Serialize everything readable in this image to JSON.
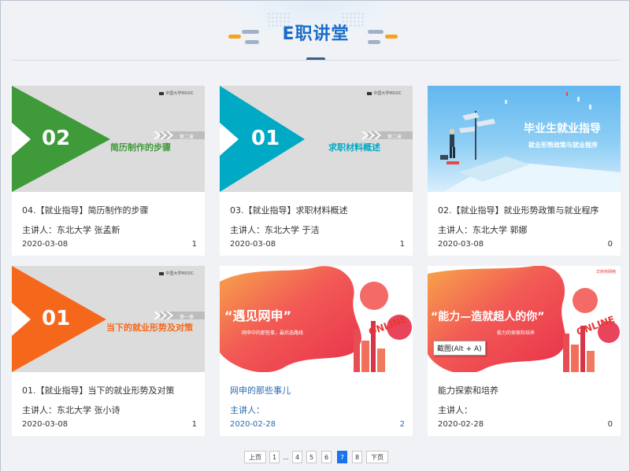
{
  "header": {
    "title": "E职讲堂"
  },
  "cards": [
    {
      "title": "04.【就业指导】简历制作的步骤",
      "speaker": "主讲人：东北大学 张孟新",
      "date": "2020-03-08",
      "count": "1",
      "thumb": {
        "num": "02",
        "subtitle": "简历制作的步骤",
        "chapter": "第二章",
        "logo": "中国大学MOOC"
      }
    },
    {
      "title": "03.【就业指导】求职材料概述",
      "speaker": "主讲人：东北大学 于洁",
      "date": "2020-03-08",
      "count": "1",
      "thumb": {
        "num": "01",
        "subtitle": "求职材料概述",
        "chapter": "第二章",
        "logo": "中国大学MOOC"
      }
    },
    {
      "title": "02.【就业指导】就业形势政策与就业程序",
      "speaker": "主讲人：东北大学 郭娜",
      "date": "2020-03-08",
      "count": "0",
      "thumb": {
        "line1": "毕业生就业指导",
        "line2": "就业形势政策与就业程序"
      }
    },
    {
      "title": "01.【就业指导】当下的就业形势及对策",
      "speaker": "主讲人：东北大学 张小诗",
      "date": "2020-03-08",
      "count": "1",
      "thumb": {
        "num": "01",
        "subtitle": "当下的就业形势及对策",
        "chapter": "第一章",
        "logo": "中国大学MOOC"
      }
    },
    {
      "title": "网申的那些事儿",
      "speaker": "主讲人：",
      "date": "2020-02-28",
      "count": "2",
      "thumb": {
        "quote": "“遇见网申”",
        "small": "网申中的那些事，最后选路线",
        "online": "ONLINE"
      }
    },
    {
      "title": "能力探索和培养",
      "speaker": "主讲人：",
      "date": "2020-02-28",
      "count": "0",
      "thumb": {
        "quote": "“能力—造就超人的你”",
        "small": "能力的探索和培养",
        "brand": "华侨商网络",
        "online": "ONLINE"
      }
    }
  ],
  "tooltip": {
    "text": "截图(Alt + A)"
  },
  "pagination": {
    "prev": "上页",
    "first": "1",
    "ellipsis": "...",
    "pages": [
      "4",
      "5",
      "6",
      "7",
      "8"
    ],
    "current": "7",
    "next": "下页"
  },
  "colors": {
    "accent": "#1a6cc8",
    "green": "#3f9a3a",
    "teal": "#00a9c4",
    "orange": "#f5681c",
    "active_page": "#1a73e8"
  }
}
